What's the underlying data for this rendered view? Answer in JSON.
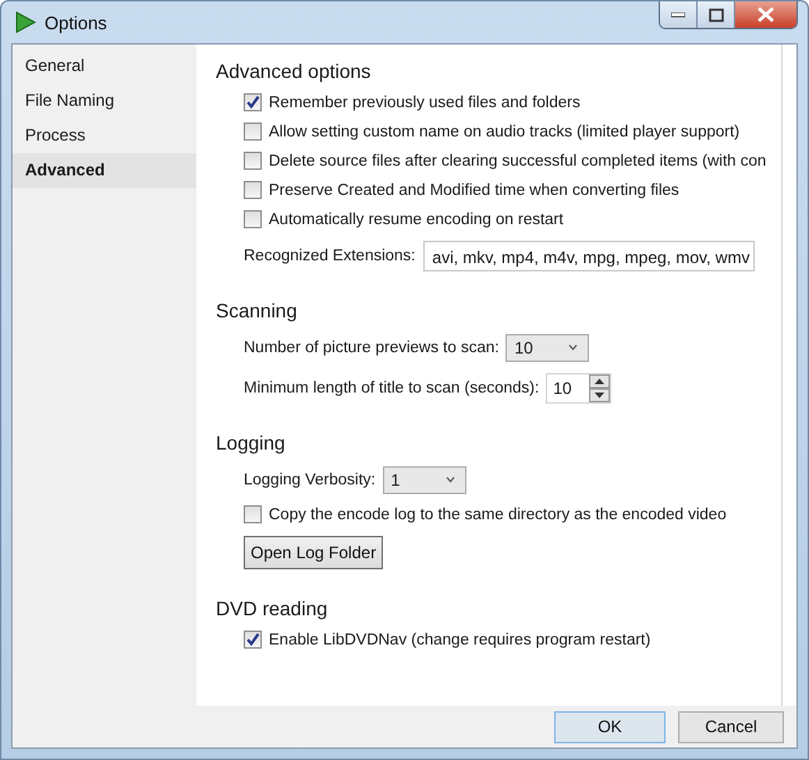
{
  "window": {
    "title": "Options"
  },
  "sidebar": {
    "items": [
      {
        "label": "General",
        "selected": false
      },
      {
        "label": "File Naming",
        "selected": false
      },
      {
        "label": "Process",
        "selected": false
      },
      {
        "label": "Advanced",
        "selected": true
      }
    ]
  },
  "sections": [
    {
      "title": "Advanced options",
      "rows": [
        {
          "kind": "checkbox",
          "label": "Remember previously used files and folders",
          "checked": true
        },
        {
          "kind": "checkbox",
          "label": "Allow setting custom name on audio tracks (limited player support)",
          "checked": false
        },
        {
          "kind": "checkbox",
          "label": "Delete source files after clearing successful completed items (with con",
          "checked": false
        },
        {
          "kind": "checkbox",
          "label": "Preserve Created and Modified time when converting files",
          "checked": false
        },
        {
          "kind": "checkbox",
          "label": "Automatically resume encoding on restart",
          "checked": false
        },
        {
          "kind": "text_field",
          "label": "Recognized Extensions:",
          "value": "avi, mkv, mp4, m4v, mpg, mpeg, mov, wmv"
        }
      ]
    },
    {
      "title": "Scanning",
      "rows": [
        {
          "kind": "dropdown",
          "label": "Number of picture previews to scan:",
          "value": "10"
        },
        {
          "kind": "spinner",
          "label": "Minimum length of title to scan (seconds):",
          "value": "10"
        }
      ]
    },
    {
      "title": "Logging",
      "rows": [
        {
          "kind": "dropdown",
          "label": "Logging Verbosity:",
          "value": "1"
        },
        {
          "kind": "checkbox",
          "label": "Copy the encode log to the same directory as the encoded video",
          "checked": false
        },
        {
          "kind": "button",
          "label": "Open Log Folder"
        }
      ]
    },
    {
      "title": "DVD reading",
      "rows": [
        {
          "kind": "checkbox",
          "label": "Enable LibDVDNav (change requires program restart)",
          "checked": true
        }
      ]
    }
  ],
  "footer": {
    "buttons": [
      {
        "label": "OK",
        "default": true
      },
      {
        "label": "Cancel",
        "default": false
      }
    ]
  }
}
